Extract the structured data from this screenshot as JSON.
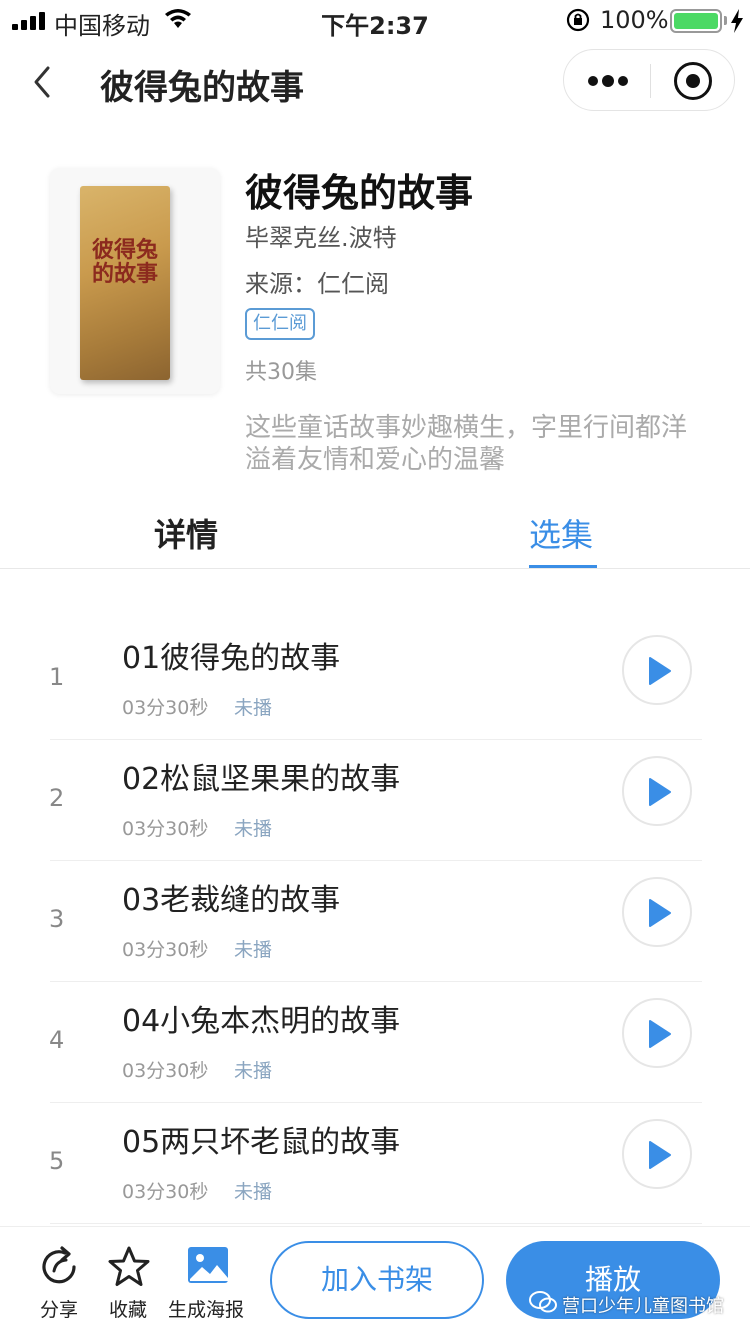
{
  "status_bar": {
    "carrier": "中国移动",
    "time": "下午2:37",
    "battery": "100%"
  },
  "nav": {
    "title": "彼得兔的故事"
  },
  "book": {
    "cover_title": "彼得兔的故事",
    "title": "彼得兔的故事",
    "author": "毕翠克丝.波特",
    "source": "来源：仁仁阅",
    "tag": "仁仁阅",
    "episodes": "共30集",
    "description": "这些童话故事妙趣横生，字里行间都洋溢着友情和爱心的温馨"
  },
  "tabs": [
    {
      "label": "详情",
      "active": false
    },
    {
      "label": "选集",
      "active": true
    }
  ],
  "episodes": [
    {
      "index": "1",
      "title": "01彼得兔的故事",
      "duration": "03分30秒",
      "status": "未播"
    },
    {
      "index": "2",
      "title": "02松鼠坚果果的故事",
      "duration": "03分30秒",
      "status": "未播"
    },
    {
      "index": "3",
      "title": "03老裁缝的故事",
      "duration": "03分30秒",
      "status": "未播"
    },
    {
      "index": "4",
      "title": "04小兔本杰明的故事",
      "duration": "03分30秒",
      "status": "未播"
    },
    {
      "index": "5",
      "title": "05两只坏老鼠的故事",
      "duration": "03分30秒",
      "status": "未播"
    }
  ],
  "bottom_bar": {
    "share": "分享",
    "favorite": "收藏",
    "poster": "生成海报",
    "add_shelf": "加入书架",
    "play": "播放"
  },
  "watermark": "营口少年儿童图书馆",
  "colors": {
    "accent": "#3a8ee6",
    "battery": "#4cd964"
  }
}
